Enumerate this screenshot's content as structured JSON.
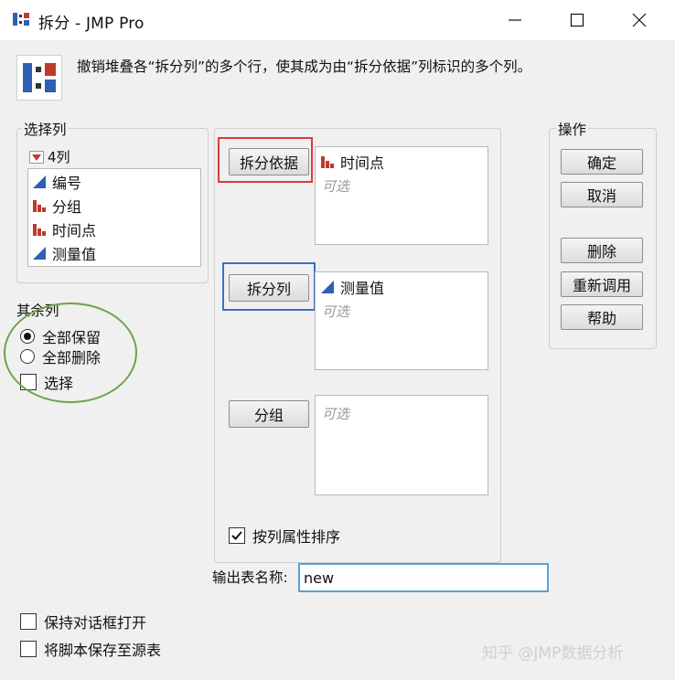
{
  "window": {
    "title": "拆分 - JMP Pro",
    "icons": {
      "app": "split-app-icon",
      "minimize": "minimize-icon",
      "maximize": "maximize-icon",
      "close": "close-icon"
    }
  },
  "description": "撤销堆叠各“拆分列”的多个行，使其成为由“拆分依据”列标识的多个列。",
  "select_columns": {
    "label": "选择列",
    "count": "4列",
    "items": [
      {
        "label": "编号",
        "icon": "continuous-icon"
      },
      {
        "label": "分组",
        "icon": "nominal-icon"
      },
      {
        "label": "时间点",
        "icon": "nominal-icon"
      },
      {
        "label": "测量值",
        "icon": "continuous-icon"
      }
    ]
  },
  "roles": {
    "split_by": {
      "button": "拆分依据",
      "item": "时间点",
      "optional": "可选"
    },
    "split_columns": {
      "button": "拆分列",
      "item": "测量值",
      "optional": "可选"
    },
    "group": {
      "button": "分组",
      "optional": "可选"
    },
    "sort_label": "按列属性排序",
    "sort_checked": true
  },
  "remaining_columns": {
    "label": "其余列",
    "options": [
      "全部保留",
      "全部删除"
    ],
    "selected": "全部保留",
    "select_label": "选择",
    "select_checked": false
  },
  "actions": {
    "label": "操作",
    "ok": "确定",
    "cancel": "取消",
    "remove": "删除",
    "recall": "重新调用",
    "help": "帮助"
  },
  "output": {
    "label": "输出表名称:",
    "value": "new"
  },
  "options": {
    "keep_open": "保持对话框打开",
    "keep_open_checked": false,
    "save_script": "将脚本保存至源表",
    "save_script_checked": false
  },
  "watermark": "知乎 @JMP数据分析",
  "colors": {
    "split_by_highlight": "#dd3a3a",
    "split_columns_highlight": "#3d6fc2",
    "remaining_highlight": "#6fa34a",
    "output_border": "#5aa2d4",
    "nominal_icon": "#c0392b",
    "continuous_icon": "#2d5fb3"
  }
}
